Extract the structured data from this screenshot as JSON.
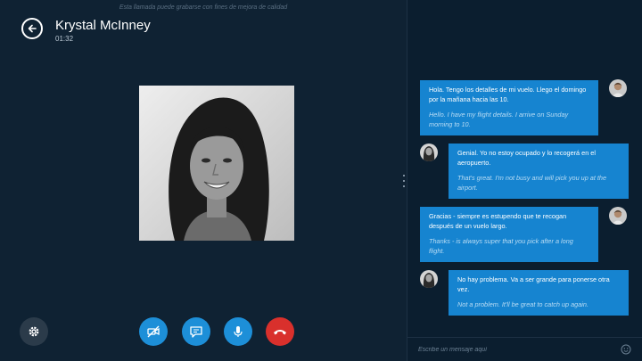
{
  "call": {
    "disclaimer": "Esta llamada puede grabarse con fines de mejora de calidad",
    "caller_name": "Krystal McInney",
    "timer": "01:32"
  },
  "controls": [
    {
      "name": "video-off",
      "icon": "video-off-icon",
      "color": "#1d8fd8"
    },
    {
      "name": "chat",
      "icon": "chat-icon",
      "color": "#1d8fd8"
    },
    {
      "name": "microphone",
      "icon": "microphone-icon",
      "color": "#1d8fd8"
    },
    {
      "name": "end-call",
      "icon": "hang-up-icon",
      "color": "#d9302c"
    }
  ],
  "chat": {
    "messages": [
      {
        "sender": "self",
        "original": "Hola. Tengo los detalles de mi vuelo. Llego el domingo por la mañana hacia las 10.",
        "translation": "Hello. I have my flight details. I arrive on Sunday morning to 10."
      },
      {
        "sender": "contact",
        "original": "Genial. Yo no estoy ocupado y lo recogerá en el aeropuerto.",
        "translation": "That's great. I'm not busy and will pick you up at the airport."
      },
      {
        "sender": "self",
        "original": "Gracias - siempre es estupendo que te recogan después de un vuelo largo.",
        "translation": "Thanks - is always super that you pick after a long flight."
      },
      {
        "sender": "contact",
        "original": "No hay problema. Va a ser grande para ponerse otra vez.",
        "translation": "Not a problem. It'll be great to catch up again."
      }
    ],
    "composer_placeholder": "Escribe un mensaje aquí"
  },
  "colors": {
    "accent": "#1684d0",
    "end_call": "#d9302c",
    "background": "#0f2233"
  }
}
